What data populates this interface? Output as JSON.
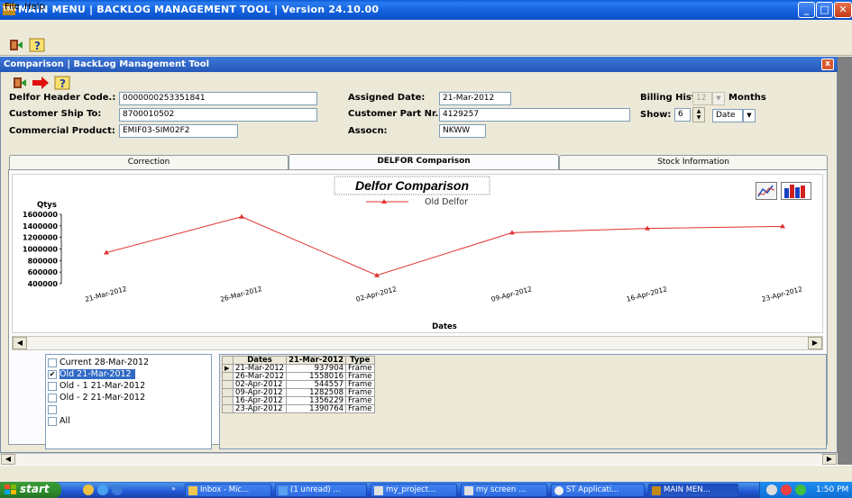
{
  "window": {
    "title": "MAIN MENU | BACKLOG MANAGEMENT TOOL |  Version  24.10.00",
    "logo_text": "TMT"
  },
  "menu": {
    "file": "File",
    "help": "Help"
  },
  "child": {
    "title": "Comparison | BackLog Management Tool",
    "close": "x"
  },
  "form": {
    "delfor_header_label": "Delfor Header Code.:",
    "delfor_header_value": "0000000253351841",
    "customer_ship_label": "Customer Ship To:",
    "customer_ship_value": "8700010502",
    "commercial_product_label": "Commercial Product:",
    "commercial_product_value": "EMIF03-SIM02F2",
    "assigned_date_label": "Assigned Date:",
    "assigned_date_value": "21-Mar-2012",
    "customer_part_label": "Customer Part Nr.:",
    "customer_part_value": "4129257",
    "assocn_label": "Assocn:",
    "assocn_value": "NKWW",
    "billing_history_label": "Billing History:",
    "billing_history_value": "12",
    "months_label": "Months",
    "show_label": "Show:",
    "show_value": "6",
    "show_unit": "Date"
  },
  "tabs": [
    {
      "label": "Correction"
    },
    {
      "label": "DELFOR Comparison"
    },
    {
      "label": "Stock Information"
    }
  ],
  "chart_data": {
    "type": "line",
    "title": "Delfor Comparison",
    "ylabel": "Qtys",
    "xlabel": "Dates",
    "categories": [
      "21-Mar-2012",
      "26-Mar-2012",
      "02-Apr-2012",
      "09-Apr-2012",
      "16-Apr-2012",
      "23-Apr-2012"
    ],
    "series": [
      {
        "name": "Old Delfor",
        "values": [
          937904,
          1558016,
          544557,
          1282508,
          1356229,
          1390764
        ],
        "color": "#e03030"
      }
    ],
    "ylim": [
      400000,
      1600000
    ],
    "yticks": [
      "1600000",
      "1400000",
      "1200000",
      "1000000",
      "800000",
      "600000",
      "400000"
    ],
    "legend": "top-center",
    "grid": false
  },
  "checklist": [
    {
      "label": "Current 28-Mar-2012",
      "checked": false,
      "selected": false
    },
    {
      "label": "Old     21-Mar-2012",
      "checked": true,
      "selected": true
    },
    {
      "label": "Old - 1  21-Mar-2012",
      "checked": false,
      "selected": false
    },
    {
      "label": "Old - 2  21-Mar-2012",
      "checked": false,
      "selected": false
    },
    {
      "label": "",
      "checked": false,
      "selected": false
    },
    {
      "label": "All",
      "checked": false,
      "selected": false
    }
  ],
  "grid": {
    "headers": [
      "Dates",
      "21-Mar-2012",
      "Type"
    ],
    "rows": [
      [
        "21-Mar-2012",
        "937904",
        "Frame"
      ],
      [
        "26-Mar-2012",
        "1558016",
        "Frame"
      ],
      [
        "02-Apr-2012",
        "544557",
        "Frame"
      ],
      [
        "09-Apr-2012",
        "1282508",
        "Frame"
      ],
      [
        "16-Apr-2012",
        "1356229",
        "Frame"
      ],
      [
        "23-Apr-2012",
        "1390764",
        "Frame"
      ]
    ]
  },
  "taskbar": {
    "start": "start",
    "tasks": [
      {
        "label": "Inbox - Mic..."
      },
      {
        "label": "(1 unread) ..."
      },
      {
        "label": "my_project..."
      },
      {
        "label": "my screen ..."
      },
      {
        "label": "ST Applicati..."
      },
      {
        "label": "MAIN MEN..."
      }
    ],
    "clock": "1:50 PM"
  },
  "colors": {
    "titlebar": "#0a5ad9",
    "series_line": "#e03030",
    "selection": "#316ac5"
  }
}
